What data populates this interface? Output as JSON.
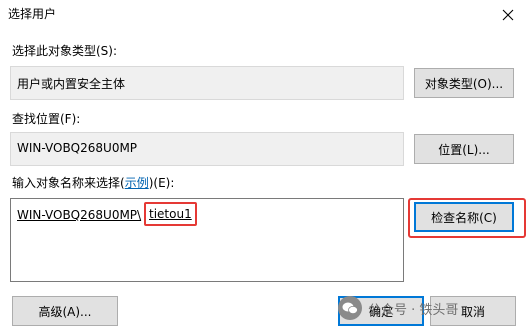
{
  "window": {
    "title": "选择用户"
  },
  "object_type": {
    "label": "选择此对象类型(S):",
    "value": "用户或内置安全主体",
    "button_label": "对象类型(O)..."
  },
  "location": {
    "label": "查找位置(F):",
    "value": "WIN-VOBQ268U0MP",
    "button_label": "位置(L)..."
  },
  "names": {
    "label_prefix": "输入对象名称来选择(",
    "label_link": "示例",
    "label_suffix": ")(E):",
    "host_value": "WIN-VOBQ268U0MP\\",
    "user_value": "tietou1",
    "check_button_label": "检查名称(C)"
  },
  "footer": {
    "advanced_label": "高级(A)...",
    "ok_label": "确定",
    "cancel_label": "取消"
  },
  "watermark": {
    "text": "公众号 · 铁头哥"
  },
  "colors": {
    "highlight": "#e53935",
    "focus": "#0078d7",
    "link": "#0063b1"
  }
}
